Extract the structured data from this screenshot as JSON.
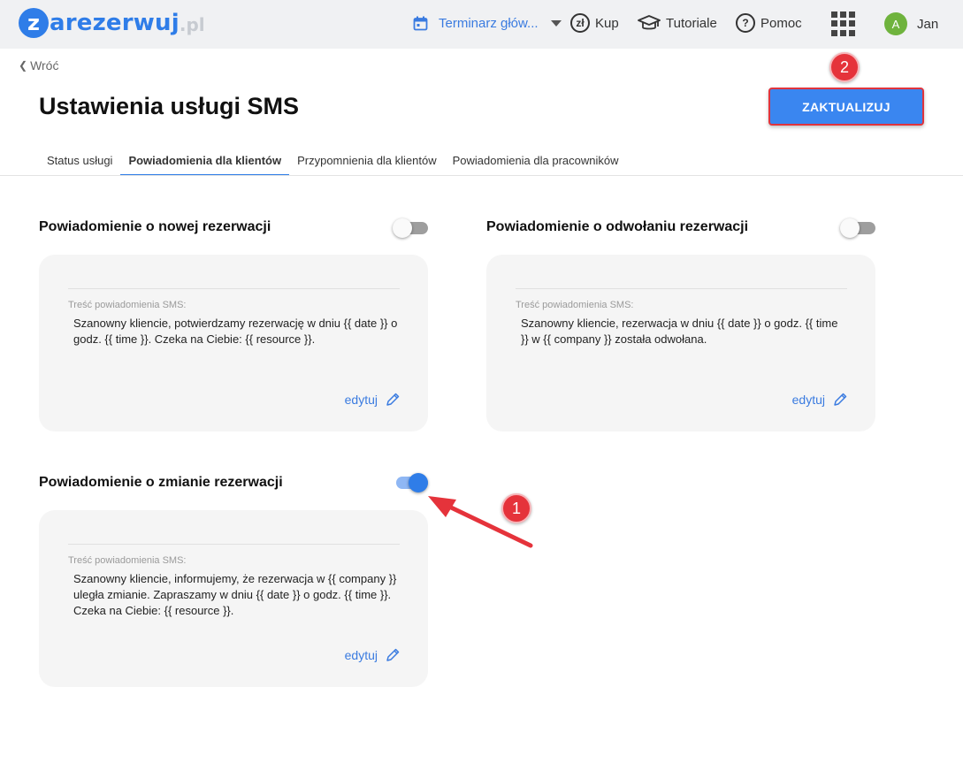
{
  "header": {
    "logo_letter": "z",
    "logo_text": "arezerwuj",
    "logo_tld": ".pl",
    "calendar_label": "Terminarz głów...",
    "buy_label": "Kup",
    "buy_icon_text": "zł",
    "tutorials_label": "Tutoriale",
    "help_label": "Pomoc",
    "avatar_initial": "A",
    "user_name": "Jan"
  },
  "page": {
    "back_label": "Wróć",
    "title": "Ustawienia usługi SMS",
    "update_button": "ZAKTUALIZUJ"
  },
  "tabs": [
    {
      "label": "Status usługi",
      "active": false
    },
    {
      "label": "Powiadomienia dla klientów",
      "active": true
    },
    {
      "label": "Przypomnienia dla klientów",
      "active": false
    },
    {
      "label": "Powiadomienia dla pracowników",
      "active": false
    }
  ],
  "notifications": [
    {
      "title": "Powiadomienie o nowej rezerwacji",
      "enabled": false,
      "content_label": "Treść powiadomienia SMS:",
      "message": "Szanowny kliencie, potwierdzamy rezerwację w dniu {{ date }} o godz. {{ time }}. Czeka na Ciebie: {{ resource }}.",
      "edit_label": "edytuj"
    },
    {
      "title": "Powiadomienie o odwołaniu rezerwacji",
      "enabled": false,
      "content_label": "Treść powiadomienia SMS:",
      "message": "Szanowny kliencie, rezerwacja w dniu {{ date }} o godz. {{ time }} w {{ company }} została odwołana.",
      "edit_label": "edytuj"
    },
    {
      "title": "Powiadomienie o zmianie rezerwacji",
      "enabled": true,
      "content_label": "Treść powiadomienia SMS:",
      "message": "Szanowny kliencie, informujemy, że rezerwacja w {{ company }} uległa zmianie. Zapraszamy w dniu {{ date }} o godz. {{ time }}. Czeka na Ciebie: {{ resource }}.",
      "edit_label": "edytuj"
    }
  ],
  "annotations": {
    "badge_1": "1",
    "badge_2": "2",
    "color": "#e5333b"
  },
  "colors": {
    "accent": "#2f7de8",
    "topbar": "#f0f1f3",
    "card": "#f5f5f5"
  }
}
